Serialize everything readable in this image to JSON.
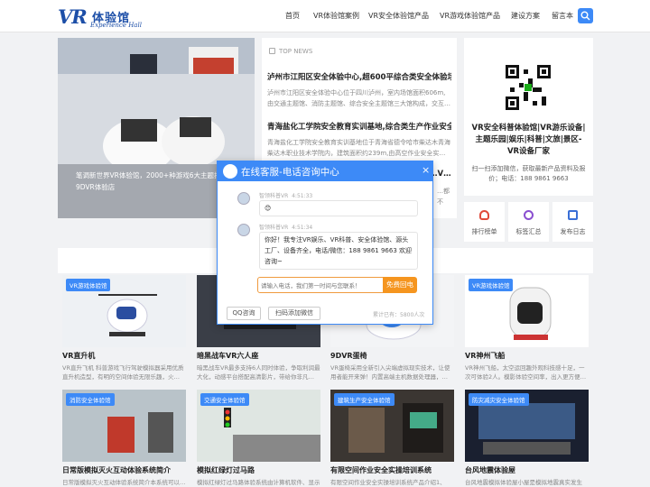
{
  "header": {
    "logo_mark": "VR",
    "logo_cn": "体验馆",
    "logo_en": "Experience Hall",
    "nav": [
      "首页",
      "VR体验馆案例",
      "VR安全体验馆产品",
      "VR游戏体验馆产品",
      "建设方案",
      "留言本"
    ]
  },
  "banner": {
    "caption_line1": "笔调新世界VR体验馆，2000+种游戏6大主题打造沉",
    "caption_line2": "9DVR体验店"
  },
  "news": {
    "heading": "TOP NEWS",
    "items": [
      {
        "title": "泸州市江阳区安全体验中心,超600平综合类安全体验场…",
        "desc": "泸州市江阳区安全体验中心位于四川泸州，室内场馆面积606m,由交通主题馆、消防主题馆、综合安全主题馆三大馆构成，交互…"
      },
      {
        "title": "青海盐化工学院安全教育实训基地,综合类生产作业安全…",
        "desc": "青海盐化工学院安全教育实训基地位于青海省德令哈市柴达木青海柴达木职业技术学院内，建筑面积约239m,由高空作业安全实…"
      },
      {
        "title": "…V…",
        "desc": "…都不"
      }
    ]
  },
  "side": {
    "title": "VR安全科普体验馆|VR游乐设备|主题乐园|娱乐|科普|文旅|景区-VR设备厂家",
    "desc": "扫一扫添加微信，获取最新产品资料及报价；电话：188 9861 9663",
    "quick": [
      "排行榜单",
      "标签汇总",
      "发布日志"
    ]
  },
  "products": [
    {
      "tag": "VR游戏体验馆",
      "title": "VR直升机",
      "desc": "VR直升飞机 科普游戏飞行驾驶模拟器采用优质直升机造型，有明的空间体验无限乐趣，火…"
    },
    {
      "tag": "",
      "title": "暗黑战车VR六人座",
      "desc": "暗黑战车VR最多支持6人同时体验，争取利润最大化，动感平台搭配高清影片，带给你非凡…"
    },
    {
      "tag": "",
      "title": "9DVR蛋椅",
      "desc": "VR蛋椅采用全新引入尖端虚拟现实技术，让使用者能开来弹！内置高端主机数据处理器，…"
    },
    {
      "tag": "VR游戏体验馆",
      "title": "VR神州飞船",
      "desc": "VR神州飞船，太空运回趣外观科技感十足，一次可体验2人。模影体验空间率，出入更方便…"
    },
    {
      "tag": "消防安全体验馆",
      "title": "日常版模拟灭火互动体验系统简介",
      "desc": "日常版模拟灭火互动体验系统简介本系统可以…"
    },
    {
      "tag": "交通安全体验馆",
      "title": "模拟红绿灯过马路",
      "desc": "模拟红绿灯过马路体验系统由计算机软件、显示设…"
    },
    {
      "tag": "建筑生产安全体验馆",
      "title": "有限空间作业安全实操培训系统",
      "desc": "有限空间作业安全实操培训系统产品介绍1、培…"
    },
    {
      "tag": "防灾减灾安全体验馆",
      "title": "台风地震体验屋",
      "desc": "台风地震模拟体验屋小屋是模拟地震真实发生的…"
    }
  ],
  "chat": {
    "title": "在线客服-电话咨询中心",
    "close": "×",
    "msg1_name": "智领科普VR",
    "msg1_time": "4:51:33",
    "msg1_text": "😊",
    "msg2_name": "智领科普VR",
    "msg2_time": "4:51:34",
    "msg2_text": "你好！我专注VR娱乐、VR科普、安全体验馆、源头工厂、设备齐全，电话/微信：188 9861 9663 欢迎咨询~",
    "input_placeholder": "请输入电话，我们第一时间与您联系！",
    "send_label": "免费回电",
    "qq_label": "QQ咨询",
    "wechat_label": "扫码添加微信",
    "count_label": "累计已有：5800人次"
  }
}
